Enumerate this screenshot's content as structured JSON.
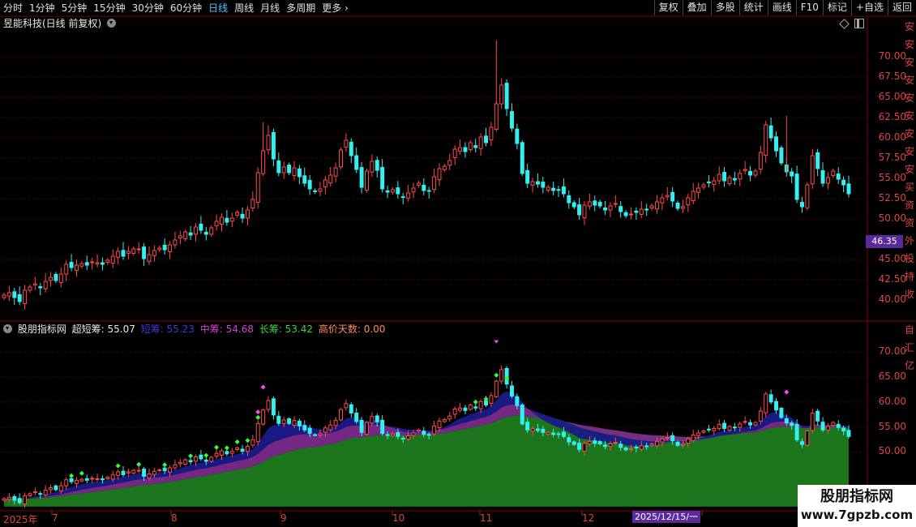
{
  "toolbar": {
    "periods": [
      "分时",
      "1分钟",
      "5分钟",
      "15分钟",
      "30分钟",
      "60分钟",
      "日线",
      "周线",
      "月线",
      "多周期",
      "更多"
    ],
    "active_period": "日线",
    "right_buttons": [
      "复权",
      "叠加",
      "多股",
      "统计",
      "画线",
      "F10",
      "标记",
      "+自选",
      "返回"
    ]
  },
  "stock": {
    "title": "昱能科技(日线 前复权)"
  },
  "main_axis": [
    "70.00",
    "67.50",
    "65.00",
    "62.50",
    "60.00",
    "57.50",
    "55.00",
    "52.50",
    "50.00",
    "45.00",
    "42.50",
    "40.00"
  ],
  "current_price": "46.35",
  "sub_axis": [
    "70.00",
    "65.00",
    "60.00",
    "55.00",
    "50.00"
  ],
  "indicator": {
    "name": "股朋指标网",
    "super_short": "超短筹: 55.07",
    "short": "短筹: 55.23",
    "mid": "中筹: 54.68",
    "long": "长筹: 53.42",
    "high_days": "高价天数: 0.00"
  },
  "colors": {
    "up": "#ff4a4a",
    "down": "#33f0f0",
    "short": "#1a1a8a",
    "mid": "#7a2a8a",
    "long": "#1e7a1e",
    "axis": "#dd4444",
    "signal": "#33ff33"
  },
  "date_axis": [
    "2025年",
    "7",
    "8",
    "9",
    "10",
    "11",
    "12"
  ],
  "cursor_date": "2025/12/15/一",
  "right_edge_main": [
    "安",
    "安",
    "安",
    "安",
    "安",
    "安",
    "安",
    "安",
    "安",
    "买",
    "资",
    "资",
    "外",
    "投",
    "持",
    "收"
  ],
  "right_edge_sub": [
    "自",
    "汇",
    "亿"
  ],
  "watermark": {
    "line1": "股朋指标网",
    "line2": "www.7gpzb.com"
  },
  "chart_data": {
    "type": "candlestick",
    "ylim": [
      38.5,
      73
    ],
    "closes": [
      40.6,
      40.9,
      40.3,
      39.8,
      41.2,
      41.6,
      42.0,
      41.5,
      42.3,
      42.8,
      42.4,
      43.2,
      44.4,
      44.0,
      44.3,
      44.5,
      44.3,
      44.7,
      44.6,
      44.4,
      44.9,
      45.4,
      46.0,
      45.4,
      46.0,
      46.3,
      46.3,
      45.1,
      45.6,
      46.1,
      46.4,
      46.2,
      46.8,
      47.4,
      47.9,
      48.4,
      48.0,
      49.0,
      48.6,
      48.1,
      48.9,
      49.7,
      50.2,
      49.6,
      50.1,
      50.8,
      50.1,
      51.1,
      52.4,
      55.7,
      58.4,
      60.3,
      57.4,
      55.7,
      56.4,
      55.7,
      56.3,
      55.2,
      54.4,
      53.7,
      53.4,
      53.7,
      54.8,
      55.4,
      56.3,
      58.5,
      59.7,
      57.8,
      56.1,
      53.9,
      55.9,
      57.1,
      56.0,
      53.7,
      53.3,
      53.6,
      53.1,
      52.7,
      53.2,
      53.8,
      54.4,
      53.5,
      53.4,
      55.2,
      56.2,
      56.5,
      57.2,
      58.6,
      58.8,
      58.3,
      59.4,
      58.8,
      60.1,
      59.4,
      61.3,
      64.2,
      66.5,
      63.6,
      61.2,
      59.3,
      55.6,
      54.4,
      54.6,
      54.3,
      53.9,
      53.9,
      53.5,
      53.6,
      53.1,
      52.0,
      51.5,
      50.5,
      51.7,
      52.1,
      51.7,
      51.6,
      51.1,
      51.6,
      51.9,
      50.9,
      50.4,
      50.6,
      50.8,
      51.2,
      51.1,
      51.6,
      52.1,
      52.6,
      52.9,
      52.2,
      51.3,
      51.5,
      52.6,
      53.4,
      53.8,
      54.2,
      54.5,
      54.7,
      55.5,
      54.7,
      55.1,
      54.8,
      55.6,
      56.1,
      55.4,
      55.9,
      58.2,
      61.6,
      60.0,
      58.4,
      56.9,
      55.8,
      55.3,
      52.4,
      51.5,
      54.2,
      57.8,
      56.2,
      54.4,
      55.1,
      55.9,
      54.9,
      54.2,
      53.1
    ],
    "short_line": "computed EMA(closes, 8)",
    "mid_line": "computed EMA(closes, 20)",
    "long_line": "computed EMA(closes, 40)"
  }
}
